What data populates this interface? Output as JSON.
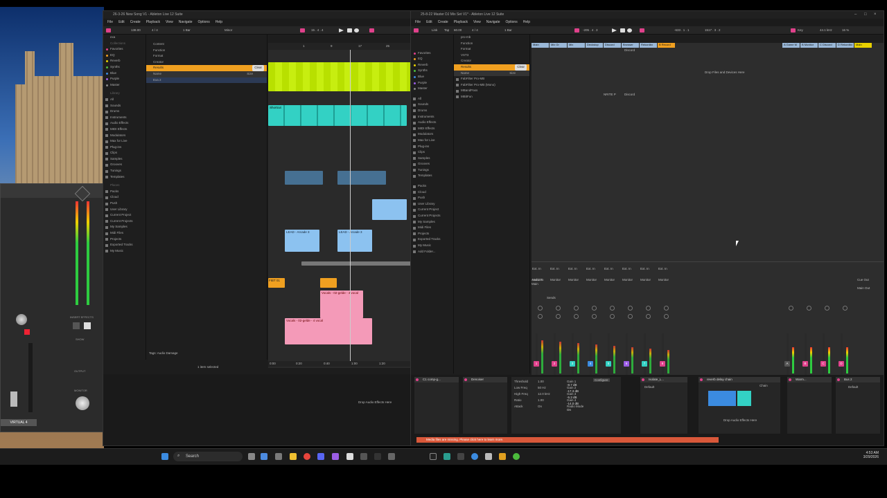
{
  "left_window": {
    "title": "26-3-26 New Song V1 - Ableton Live 12 Suite",
    "menu": [
      "File",
      "Edit",
      "Create",
      "Playback",
      "View",
      "Navigate",
      "Options",
      "Help"
    ],
    "transport": {
      "tempo": "138.00",
      "time_sig": "4 / 4",
      "bars": "1 Bar",
      "key": "Minor",
      "position": "15 . 4 . 4"
    },
    "search_text": "exa",
    "filter_labels": [
      "Content",
      "Function",
      "Format",
      "Creator"
    ],
    "results_label": "Results",
    "clear_label": "Clear",
    "name_col": "Name",
    "size_col": "Size",
    "result_item": "Exa 2",
    "collections_label": "Collections",
    "collections": [
      {
        "label": "Favorites",
        "color": "#e0418b"
      },
      {
        "label": "EQ",
        "color": "#f0a020"
      },
      {
        "label": "Reverb",
        "color": "#e8d000"
      },
      {
        "label": "Synths",
        "color": "#4cbb3c"
      },
      {
        "label": "Blue",
        "color": "#3b8be0"
      },
      {
        "label": "Purple",
        "color": "#9b5de5"
      },
      {
        "label": "Master",
        "color": "#888888"
      }
    ],
    "library_label": "Library",
    "library": [
      "All",
      "Sounds",
      "Drums",
      "Instruments",
      "Audio Effects",
      "MIDI Effects",
      "Modulators",
      "Max for Live",
      "Plug-ins",
      "Clips",
      "Samples",
      "Grooves",
      "Tunings",
      "Templates"
    ],
    "places_label": "Places",
    "places": [
      "Packs",
      "Cloud",
      "Push",
      "User Library",
      "Current Project",
      "Current Projects",
      "My Samples",
      "Midi Files",
      "Projects",
      "Exported Tracks",
      "My Music"
    ],
    "clip_labels": {
      "shortcut": "Shortcut",
      "lead": "LEAD - Arcade 3",
      "vocals": "Vocals - 02-gelde - 4 vocal",
      "fx": "FIBT 01"
    },
    "ruler": [
      "1",
      "9",
      "17",
      "25"
    ],
    "time_ruler": [
      "0:00",
      "0:20",
      "0:40",
      "1:00",
      "1:20"
    ],
    "tags_label": "Tags:",
    "tags_value": "Audio Damage",
    "status": "1 item selected",
    "drop_effects": "Drop Audio Effects Here",
    "rack_label": "VIRTUAL 4",
    "rack_labels": [
      "INSERT EFFECTS",
      "SHOW",
      "OUTPUT",
      "MONITOR"
    ]
  },
  "right_window": {
    "title": "25-8-22 Master DJ Mix Set V1* - Ableton Live 12 Suite",
    "menu": [
      "File",
      "Edit",
      "Create",
      "Playback",
      "View",
      "Navigate",
      "Options",
      "Help"
    ],
    "transport": {
      "mode": "Link",
      "tap": "Tap",
      "tempo": "60.00",
      "time_sig": "4 / 4",
      "bars": "1 Bar",
      "position": "-205 . 4 . 3",
      "pos2": "-633 . 1 . 1",
      "pos3": "1517 . 3 . 2",
      "key": "Key",
      "cpu": "44.1 kHz",
      "percent": "16 %"
    },
    "search_text": "pro-mb",
    "filter_labels": [
      "Function",
      "Format",
      "VST3",
      "Creator"
    ],
    "results_label": "Results",
    "clear_label": "Clear",
    "name_col": "Name",
    "size_col": "Size",
    "results": [
      "FabFilter Pro-MB",
      "FabFilter Pro-MB (Mono)",
      "MBandPass",
      "MBitFun"
    ],
    "library": [
      "All",
      "Sounds",
      "Drums",
      "Instruments",
      "Audio Effects",
      "MIDI Effects",
      "Modulators",
      "Max for Live",
      "Plug-ins",
      "Clips",
      "Samples",
      "Grooves",
      "Tunings",
      "Templates"
    ],
    "places": [
      "Packs",
      "Cloud",
      "Push",
      "User Library",
      "Current Project",
      "Current Projects",
      "My Samples",
      "Midi Files",
      "Projects",
      "Exported Tracks",
      "My Music",
      "Add Folder..."
    ],
    "tracks": [
      "Main",
      "Mix Gr",
      "Mix",
      "Deckstop",
      "Discord",
      "Browser",
      "Rekordbx",
      "B Record"
    ],
    "tracks_right": [
      "A Game M",
      "B Monitor",
      "C Discord",
      "D Rekordbx",
      "Main"
    ],
    "drop_files": "Drop Files and Devices Here",
    "clip_slot_labels": [
      "Discord",
      "NRITE P",
      "Discord"
    ],
    "channel_numbers": [
      "1",
      "2",
      "3",
      "4",
      "5",
      "6",
      "7",
      "8"
    ],
    "right_numbers": [
      "A",
      "B",
      "C",
      "D"
    ],
    "sends_label": "Sends",
    "io_labels": {
      "audio_to": "Audio To",
      "main": "Main",
      "ext_in": "Ext. In",
      "monitor": "Monitor",
      "cue_out": "Cue Out",
      "main_out": "Main Out"
    },
    "devices": {
      "comp": "C1 comp-g...",
      "denoiser": "Denoiser",
      "eq_params": [
        "Threshold",
        "Low Freq",
        "High Freq",
        "Ratio",
        "Attack"
      ],
      "eq_values": [
        "1.00",
        "50 Hz",
        "12.0 kHz",
        "1.00",
        "On"
      ],
      "gain_params": [
        "Gain 1",
        "Gain 2",
        "Gain 3",
        "Gain 4",
        "Radio Mode"
      ],
      "gain_values": [
        "-8.7 dB",
        "-17.3 dB",
        "-5.3 dB",
        "-14.0 dB",
        "On"
      ],
      "configure": "Configure",
      "isolate": "Isolate_L...",
      "default": "Default",
      "reverb": "reverb delay chain",
      "chain": "Chain",
      "warm": "Warm...",
      "bus": "Bus 2",
      "drop_effects": "Drop Audio Effects Here"
    },
    "warning": "Media files are missing. Please click here to learn more."
  },
  "taskbar": {
    "search_placeholder": "Search",
    "time": "4:53 AM",
    "date": "3/29/2026"
  },
  "colors": {
    "accent": "#e0418b",
    "lime": "#b8e000",
    "teal": "#33d1c4",
    "lead_blue": "#8cc2f0",
    "vocal_pink": "#f49ab8",
    "orange": "#f0a020",
    "warning": "#d9583a"
  }
}
